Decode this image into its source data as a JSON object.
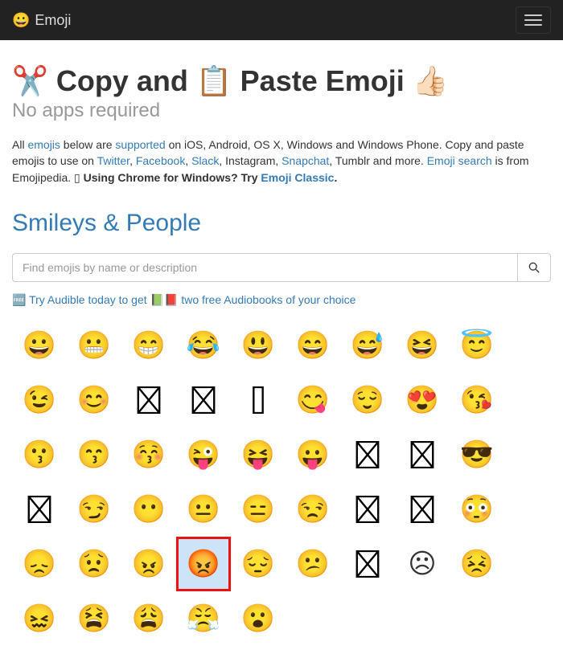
{
  "navbar": {
    "brand_emoji": "😀",
    "brand": "Emoji"
  },
  "header": {
    "title_prefix": "✂️ Copy and ",
    "title_mid": "📋",
    "title_suffix": " Paste Emoji 👍🏻",
    "subheading": "No apps required"
  },
  "lead": {
    "t1": "All ",
    "link_emojis": "emojis",
    "t2": " below are ",
    "link_supported": "supported",
    "t3": " on iOS, Android, OS X, Windows and Windows Phone. Copy and paste emojis to use on ",
    "link_twitter": "Twitter",
    "sep1": ", ",
    "link_facebook": "Facebook",
    "sep2": ", ",
    "link_slack": "Slack",
    "t4": ", Instagram, ",
    "link_snapchat": "Snapchat",
    "t5": ", Tumblr and more. ",
    "link_emojisearch": "Emoji search",
    "t6": " is from Emojipedia. ",
    "missing": "▯ ",
    "bold1": "Using Chrome for Windows? Try ",
    "link_classic": "Emoji Classic",
    "bold2": "."
  },
  "section": {
    "title": "Smileys & People"
  },
  "search": {
    "placeholder": "Find emojis by name or description"
  },
  "promo": {
    "p1": "🆓 ",
    "link1": "Try Audible today to get",
    "p2": " 📗📕 ",
    "link2": "two free Audiobooks of your choice"
  },
  "emojis": [
    {
      "name": "grinning",
      "char": "😀"
    },
    {
      "name": "grimacing",
      "char": "😬"
    },
    {
      "name": "grin",
      "char": "😁"
    },
    {
      "name": "joy",
      "char": "😂"
    },
    {
      "name": "smiley",
      "char": "😃"
    },
    {
      "name": "smile",
      "char": "😄"
    },
    {
      "name": "sweat-smile",
      "char": "😅"
    },
    {
      "name": "laughing",
      "char": "😆"
    },
    {
      "name": "innocent",
      "char": "😇"
    },
    {
      "name": "wink",
      "char": "😉"
    },
    {
      "name": "blush",
      "char": "😊"
    },
    {
      "name": "slightly-smiling",
      "tofu": true
    },
    {
      "name": "upside-down",
      "tofu": true
    },
    {
      "name": "relaxed",
      "narrow": true
    },
    {
      "name": "yum",
      "char": "😋"
    },
    {
      "name": "relieved",
      "char": "😌"
    },
    {
      "name": "heart-eyes",
      "char": "😍"
    },
    {
      "name": "kissing-heart",
      "char": "😘"
    },
    {
      "name": "kissing",
      "char": "😗"
    },
    {
      "name": "kissing-smiling-eyes",
      "char": "😙"
    },
    {
      "name": "kissing-closed-eyes",
      "char": "😚"
    },
    {
      "name": "stuck-out-tongue-wink",
      "char": "😜"
    },
    {
      "name": "stuck-out-tongue-closed",
      "char": "😝"
    },
    {
      "name": "stuck-out-tongue",
      "char": "😛"
    },
    {
      "name": "money-mouth",
      "tofu": true
    },
    {
      "name": "nerd",
      "tofu": true
    },
    {
      "name": "sunglasses",
      "char": "😎"
    },
    {
      "name": "hugging",
      "tofu": true
    },
    {
      "name": "smirk",
      "char": "😏"
    },
    {
      "name": "no-mouth",
      "char": "😶"
    },
    {
      "name": "neutral",
      "char": "😐"
    },
    {
      "name": "expressionless",
      "char": "😑"
    },
    {
      "name": "unamused",
      "char": "😒"
    },
    {
      "name": "rolling-eyes",
      "tofu": true
    },
    {
      "name": "thinking",
      "tofu": true
    },
    {
      "name": "flushed",
      "char": "😳"
    },
    {
      "name": "disappointed",
      "char": "😞"
    },
    {
      "name": "worried",
      "char": "😟"
    },
    {
      "name": "angry",
      "char": "😠"
    },
    {
      "name": "rage",
      "char": "😡",
      "highlighted": true
    },
    {
      "name": "pensive",
      "char": "😔"
    },
    {
      "name": "confused",
      "char": "😕"
    },
    {
      "name": "slightly-frowning",
      "tofu": true
    },
    {
      "name": "frowning-2",
      "char": "☹"
    },
    {
      "name": "persevere",
      "char": "😣"
    },
    {
      "name": "confounded",
      "char": "😖"
    },
    {
      "name": "tired-face",
      "char": "😫"
    },
    {
      "name": "weary",
      "char": "😩"
    },
    {
      "name": "triumph",
      "char": "😤"
    },
    {
      "name": "open-mouth",
      "char": "😮"
    }
  ]
}
